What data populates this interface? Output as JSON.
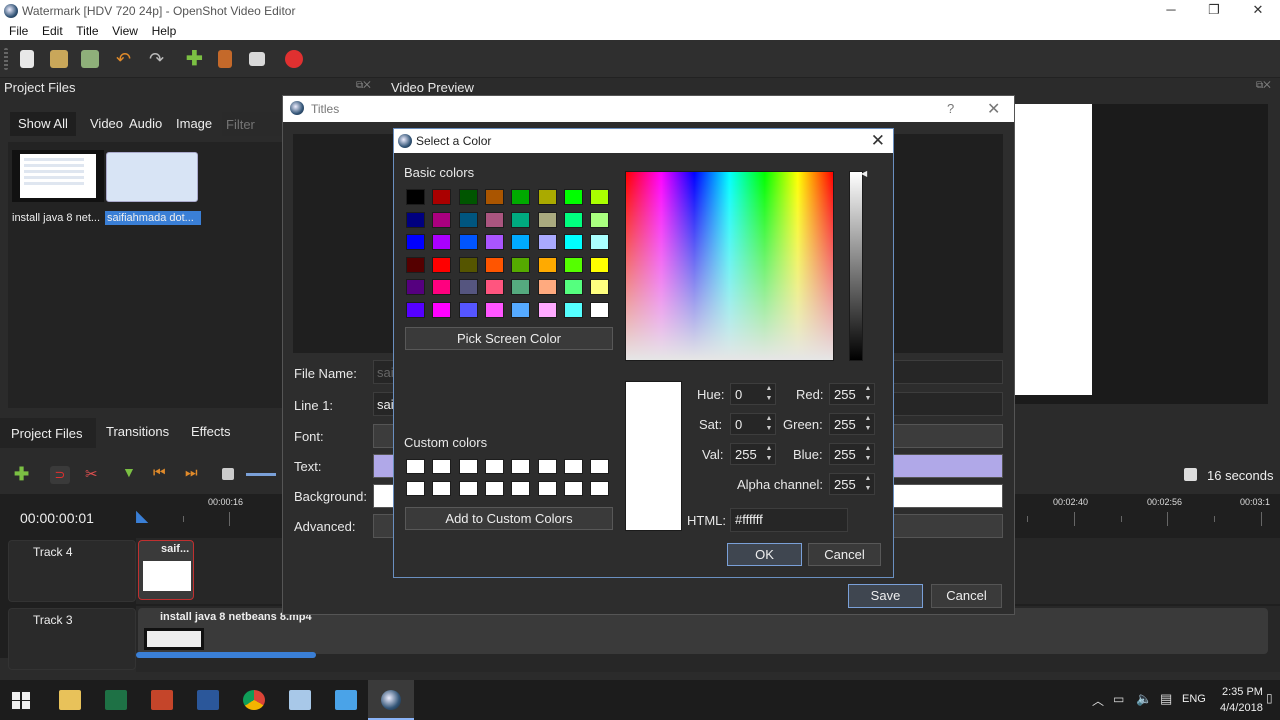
{
  "window": {
    "title": "Watermark [HDV 720 24p] - OpenShot Video Editor"
  },
  "menu": [
    "File",
    "Edit",
    "Title",
    "View",
    "Help"
  ],
  "project_files": {
    "title": "Project Files",
    "filters": [
      "Show All",
      "Video",
      "Audio",
      "Image"
    ],
    "filter_placeholder": "Filter",
    "items": [
      {
        "label": "install java 8 net..."
      },
      {
        "label": "saifiahmada dot..."
      }
    ]
  },
  "video_preview": {
    "title": "Video Preview"
  },
  "bottom_tabs": [
    "Project Files",
    "Transitions",
    "Effects"
  ],
  "timeline": {
    "timecode": "00:00:00:01",
    "zoom_label": "16 seconds",
    "ruler": [
      "00:00:16",
      "00:02:40",
      "00:02:56",
      "00:03:1"
    ],
    "tracks": [
      {
        "name": "Track 4",
        "clip": "saif..."
      },
      {
        "name": "Track 3",
        "clip": "install java 8 netbeans 8.mp4"
      }
    ]
  },
  "titles_dialog": {
    "title": "Titles",
    "help": "?",
    "labels": {
      "file_name": "File Name:",
      "line1": "Line 1:",
      "font": "Font:",
      "text": "Text:",
      "background": "Background:",
      "advanced": "Advanced:"
    },
    "file_name_value": "sai",
    "line1_value": "sai",
    "save": "Save",
    "cancel": "Cancel"
  },
  "color_dialog": {
    "title": "Select a Color",
    "basic_colors_label": "Basic colors",
    "basic_colors": [
      [
        "#000000",
        "#aa0000",
        "#005500",
        "#aa5500",
        "#00aa00",
        "#aaaa00",
        "#00ff00",
        "#aaff00"
      ],
      [
        "#00007f",
        "#aa007f",
        "#00557f",
        "#aa557f",
        "#00aa7f",
        "#aaaa7f",
        "#00ff7f",
        "#aaff7f"
      ],
      [
        "#0000ff",
        "#aa00ff",
        "#0055ff",
        "#aa55ff",
        "#00aaff",
        "#aaaaff",
        "#00ffff",
        "#aaffff"
      ],
      [
        "#550000",
        "#ff0000",
        "#555500",
        "#ff5500",
        "#55aa00",
        "#ffaa00",
        "#55ff00",
        "#ffff00"
      ],
      [
        "#55007f",
        "#ff007f",
        "#55557f",
        "#ff557f",
        "#55aa7f",
        "#ffaa7f",
        "#55ff7f",
        "#ffff7f"
      ],
      [
        "#5500ff",
        "#ff00ff",
        "#5555ff",
        "#ff55ff",
        "#55aaff",
        "#ffaaff",
        "#55ffff",
        "#ffffff"
      ]
    ],
    "pick_screen": "Pick Screen Color",
    "custom_colors_label": "Custom colors",
    "add_custom": "Add to Custom Colors",
    "hue_label": "Hue:",
    "hue": "0",
    "sat_label": "Sat:",
    "sat": "0",
    "val_label": "Val:",
    "val": "255",
    "red_label": "Red:",
    "red": "255",
    "green_label": "Green:",
    "green": "255",
    "blue_label": "Blue:",
    "blue": "255",
    "alpha_label": "Alpha channel:",
    "alpha": "255",
    "html_label": "HTML:",
    "html": "#ffffff",
    "ok": "OK",
    "cancel": "Cancel"
  },
  "taskbar": {
    "time": "2:35 PM",
    "date": "4/4/2018",
    "lang": "ENG"
  }
}
